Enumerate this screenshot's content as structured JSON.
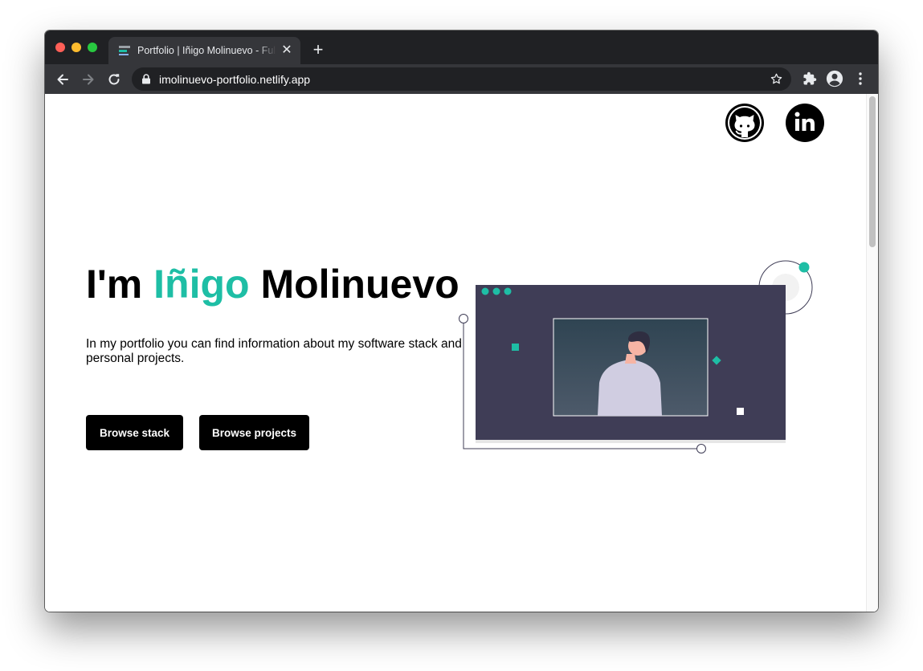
{
  "browser": {
    "tab_title": "Portfolio | Iñigo Molinuevo - Full Stack Developer",
    "tab_close": "✕",
    "new_tab": "+",
    "url": "imolinuevo-portfolio.netlify.app"
  },
  "social": {
    "github_icon": "github-icon",
    "linkedin_icon": "linkedin-icon"
  },
  "hero": {
    "title_prefix": "I'm ",
    "title_highlight": "Iñigo",
    "title_suffix": " Molinuevo",
    "description": "In my portfolio you can find information about my software stack and personal projects.",
    "buttons": {
      "stack": "Browse stack",
      "projects": "Browse projects"
    }
  },
  "colors": {
    "accent": "#1ebea5",
    "button_bg": "#000000",
    "browser_dark": "#202124",
    "browser_toolbar": "#35363a",
    "illustration_panel": "#3f3d56"
  },
  "illustration": {
    "icon": "developer-profile-illustration"
  }
}
